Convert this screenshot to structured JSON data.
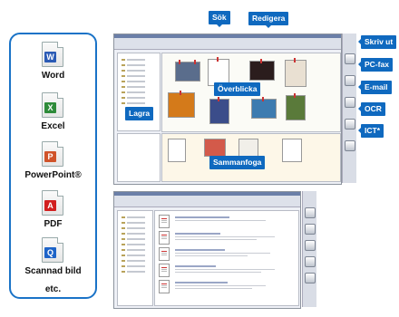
{
  "file_types": [
    {
      "label": "Word",
      "icon": "word-icon",
      "badge": "W",
      "color": "#2b5bb5"
    },
    {
      "label": "Excel",
      "icon": "excel-icon",
      "badge": "X",
      "color": "#2e8b3a"
    },
    {
      "label": "PowerPoint®",
      "icon": "powerpoint-icon",
      "badge": "P",
      "color": "#d0532a"
    },
    {
      "label": "PDF",
      "icon": "pdf-icon",
      "badge": "A",
      "color": "#d11f1f"
    },
    {
      "label": "Scannad bild",
      "icon": "scanned-image-icon",
      "badge": "Q",
      "color": "#1e64c8"
    }
  ],
  "etc_label": "etc.",
  "callouts": {
    "search": "Sök",
    "edit": "Redigera",
    "print": "Skriv ut",
    "pc_fax": "PC-fax",
    "email": "E-mail",
    "ocr": "OCR",
    "ict": "ICT*",
    "overview": "Överblicka",
    "store": "Lagra",
    "merge": "Sammanfoga"
  },
  "colors": {
    "accent": "#0f69bf",
    "panel_border": "#1a73c7"
  }
}
